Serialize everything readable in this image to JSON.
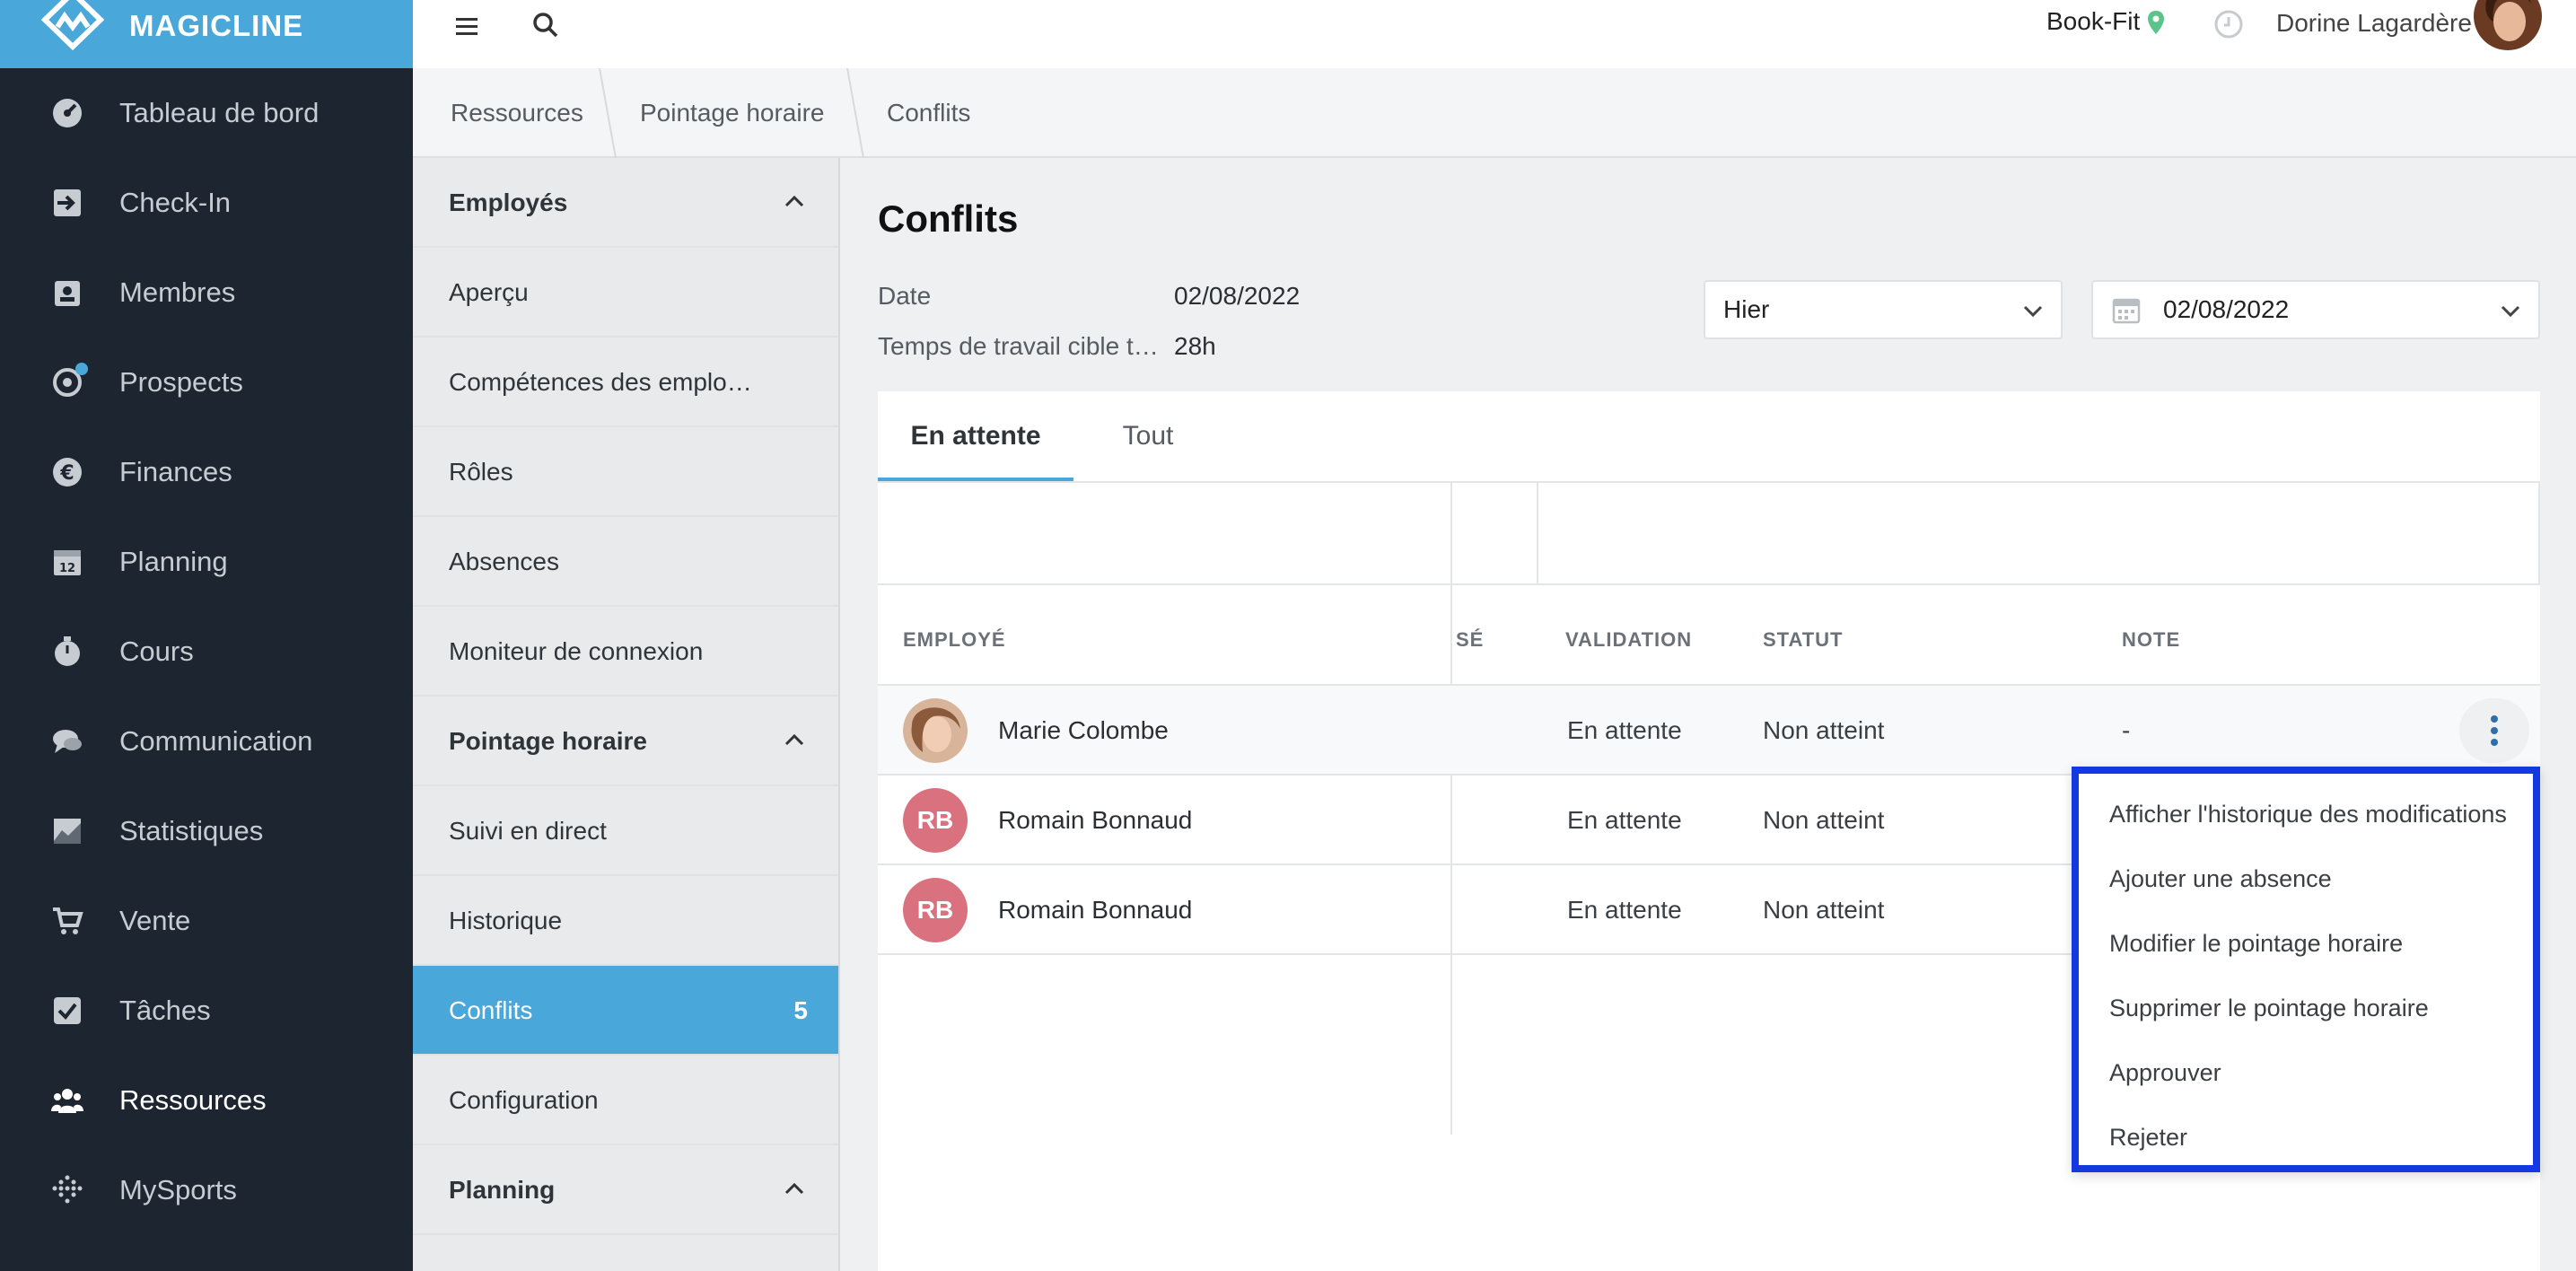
{
  "brand": {
    "name": "MAGICLINE"
  },
  "nav": {
    "items": [
      {
        "label": "Tableau de bord",
        "icon": "dashboard-icon"
      },
      {
        "label": "Check-In",
        "icon": "checkin-icon"
      },
      {
        "label": "Membres",
        "icon": "members-icon"
      },
      {
        "label": "Prospects",
        "icon": "prospects-icon"
      },
      {
        "label": "Finances",
        "icon": "euro-icon"
      },
      {
        "label": "Planning",
        "icon": "calendar-icon"
      },
      {
        "label": "Cours",
        "icon": "stopwatch-icon"
      },
      {
        "label": "Communication",
        "icon": "chat-icon"
      },
      {
        "label": "Statistiques",
        "icon": "chart-icon"
      },
      {
        "label": "Vente",
        "icon": "cart-icon"
      },
      {
        "label": "Tâches",
        "icon": "checkbox-icon"
      },
      {
        "label": "Ressources",
        "icon": "people-icon"
      },
      {
        "label": "MySports",
        "icon": "mysports-icon"
      }
    ],
    "active": "Ressources"
  },
  "topbar": {
    "studio": "Book-Fit",
    "user": "Dorine Lagardère"
  },
  "breadcrumb": [
    "Ressources",
    "Pointage horaire",
    "Conflits"
  ],
  "subnav": {
    "employees_header": "Employés",
    "employees_items": [
      "Aperçu",
      "Compétences des emplo…",
      "Rôles",
      "Absences",
      "Moniteur de connexion"
    ],
    "timeclock_header": "Pointage horaire",
    "timeclock_items": [
      "Suivi en direct",
      "Historique",
      "Conflits",
      "Configuration"
    ],
    "conflicts_count": "5",
    "planning_header": "Planning"
  },
  "main": {
    "title": "Conflits",
    "date_label": "Date",
    "date_value": "02/08/2022",
    "target_label": "Temps de travail cible t…",
    "target_value": "28h",
    "period_select": "Hier",
    "date_picker": "02/08/2022",
    "tabs": [
      "En attente",
      "Tout"
    ],
    "columns": [
      "EMPLOYÉ",
      "SÉ",
      "VALIDATION",
      "STATUT",
      "NOTE"
    ],
    "rows": [
      {
        "name": "Marie Colombe",
        "initials": "",
        "validation": "En attente",
        "status": "Non atteint",
        "note": "-"
      },
      {
        "name": "Romain Bonnaud",
        "initials": "RB",
        "validation": "En attente",
        "status": "Non atteint",
        "note": ""
      },
      {
        "name": "Romain Bonnaud",
        "initials": "RB",
        "validation": "En attente",
        "status": "Non atteint",
        "note": ""
      }
    ]
  },
  "context_menu": [
    "Afficher l'historique des modifications",
    "Ajouter une absence",
    "Modifier le pointage horaire",
    "Supprimer le pointage horaire",
    "Approuver",
    "Rejeter"
  ],
  "colors": {
    "brand_blue": "#4aa7d9",
    "nav_bg": "#1c2530",
    "avatar_initials_bg": "#d9727e",
    "highlight_border": "#1539e0"
  }
}
